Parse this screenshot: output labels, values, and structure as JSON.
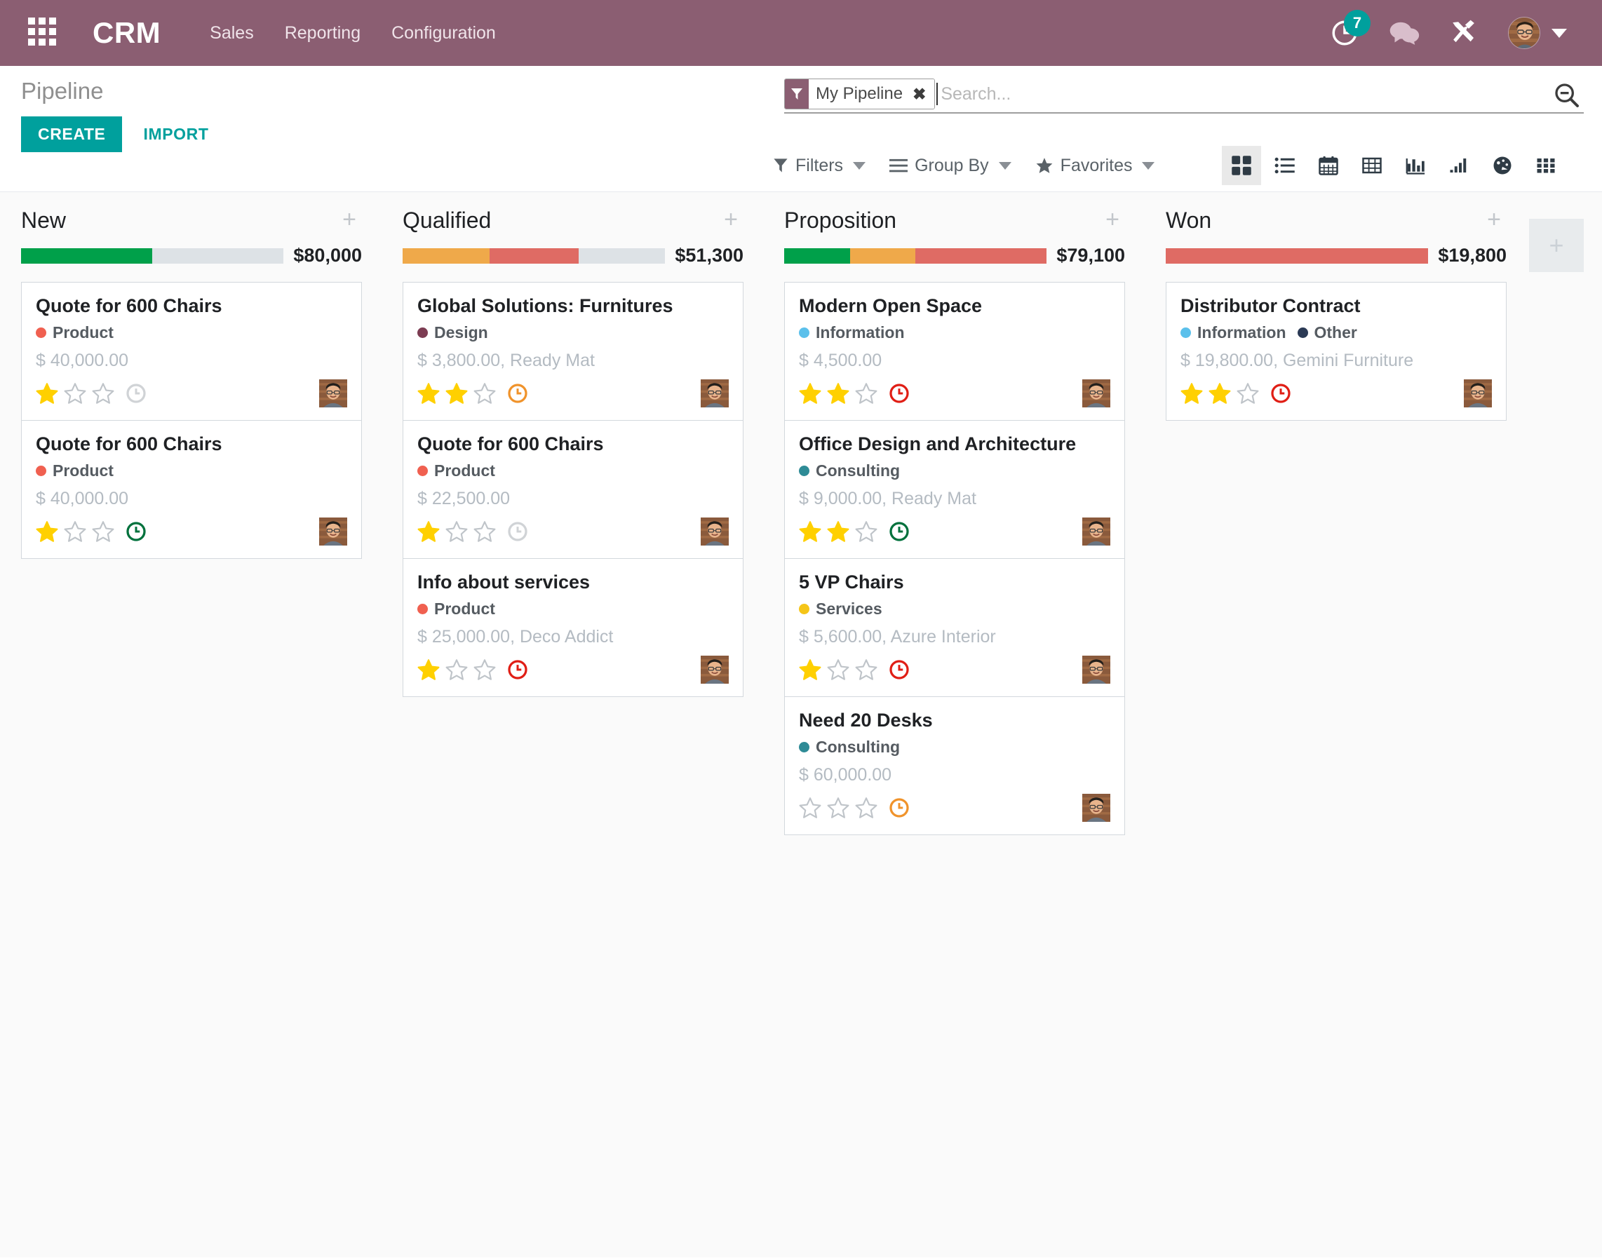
{
  "navbar": {
    "apps_icon": "apps-grid-icon",
    "brand": "CRM",
    "menu": [
      {
        "label": "Sales"
      },
      {
        "label": "Reporting"
      },
      {
        "label": "Configuration"
      }
    ],
    "activity_icon": "clock-activity-icon",
    "activity_count": "7",
    "messages_icon": "chat-bubbles-icon",
    "tools_icon": "tools-wrench-icon",
    "avatar_icon": "user-avatar",
    "user_caret_icon": "chevron-down-icon",
    "colors": {
      "bar": "#8B5E72",
      "badge": "#00A09D"
    }
  },
  "control_panel": {
    "title": "Pipeline",
    "create_label": "CREATE",
    "import_label": "IMPORT",
    "search": {
      "facet_label": "My Pipeline",
      "facet_icon": "filter-funnel-icon",
      "facet_close_icon": "close-x-icon",
      "placeholder": "Search...",
      "value": "",
      "magnifier_icon": "search-icon"
    },
    "filters_label": "Filters",
    "filters_icon": "filter-funnel-icon",
    "groupby_label": "Group By",
    "groupby_icon": "hamburger-lines-icon",
    "favorites_label": "Favorites",
    "favorites_icon": "star-icon",
    "views": [
      {
        "name": "kanban",
        "icon": "kanban-view-icon",
        "active": true
      },
      {
        "name": "list",
        "icon": "list-view-icon",
        "active": false
      },
      {
        "name": "calendar",
        "icon": "calendar-view-icon",
        "active": false
      },
      {
        "name": "pivot",
        "icon": "pivot-table-icon",
        "active": false
      },
      {
        "name": "graph",
        "icon": "bar-chart-icon",
        "active": false
      },
      {
        "name": "cohort",
        "icon": "ascending-bars-icon",
        "active": false
      },
      {
        "name": "dashboard",
        "icon": "gauge-dashboard-icon",
        "active": false
      },
      {
        "name": "activity",
        "icon": "grid-dots-icon",
        "active": false
      }
    ]
  },
  "colors": {
    "teal": "#00A09D",
    "green": "#00A04A",
    "orange": "#EFA94A",
    "red": "#DF6B64",
    "gray_bar": "#DDE2E6",
    "star_gold": "#FFD000",
    "clock_green": "#00713C",
    "clock_orange": "#F0932B",
    "clock_red": "#E01E15",
    "clock_gray": "#D0D3D6"
  },
  "kanban": {
    "add_column_icon": "plus-icon",
    "columns": [
      {
        "title": "New",
        "add_icon": "plus-icon",
        "amount": "$80,000",
        "progress": [
          {
            "color": "#00A04A",
            "pct": 50
          },
          {
            "color": "#DDE2E6",
            "pct": 50
          }
        ],
        "cards": [
          {
            "title": "Quote for 600 Chairs",
            "tags": [
              {
                "label": "Product",
                "color": "#F06050"
              }
            ],
            "amount": "$ 40,000.00",
            "stars_filled": 1,
            "stars_total": 3,
            "clock": "gray",
            "avatar": "user-avatar"
          },
          {
            "title": "Quote for 600 Chairs",
            "tags": [
              {
                "label": "Product",
                "color": "#F06050"
              }
            ],
            "amount": "$ 40,000.00",
            "stars_filled": 1,
            "stars_total": 3,
            "clock": "green",
            "avatar": "user-avatar"
          }
        ]
      },
      {
        "title": "Qualified",
        "add_icon": "plus-icon",
        "amount": "$51,300",
        "progress": [
          {
            "color": "#EFA94A",
            "pct": 33
          },
          {
            "color": "#DF6B64",
            "pct": 34
          },
          {
            "color": "#DDE2E6",
            "pct": 33
          }
        ],
        "cards": [
          {
            "title": "Global Solutions: Furnitures",
            "tags": [
              {
                "label": "Design",
                "color": "#7C3C52"
              }
            ],
            "amount": "$ 3,800.00, Ready Mat",
            "stars_filled": 2,
            "stars_total": 3,
            "clock": "orange",
            "avatar": "user-avatar"
          },
          {
            "title": "Quote for 600 Chairs",
            "tags": [
              {
                "label": "Product",
                "color": "#F06050"
              }
            ],
            "amount": "$ 22,500.00",
            "stars_filled": 1,
            "stars_total": 3,
            "clock": "gray",
            "avatar": "user-avatar"
          },
          {
            "title": "Info about services",
            "tags": [
              {
                "label": "Product",
                "color": "#F06050"
              }
            ],
            "amount": "$ 25,000.00, Deco Addict",
            "stars_filled": 1,
            "stars_total": 3,
            "clock": "red",
            "avatar": "user-avatar"
          }
        ]
      },
      {
        "title": "Proposition",
        "add_icon": "plus-icon",
        "amount": "$79,100",
        "progress": [
          {
            "color": "#00A04A",
            "pct": 25
          },
          {
            "color": "#EFA94A",
            "pct": 25
          },
          {
            "color": "#DF6B64",
            "pct": 50
          }
        ],
        "cards": [
          {
            "title": "Modern Open Space",
            "tags": [
              {
                "label": "Information",
                "color": "#5BC0EB"
              }
            ],
            "amount": "$ 4,500.00",
            "stars_filled": 2,
            "stars_total": 3,
            "clock": "red",
            "avatar": "user-avatar"
          },
          {
            "title": "Office Design and Architecture",
            "tags": [
              {
                "label": "Consulting",
                "color": "#2E8B96"
              }
            ],
            "amount": "$ 9,000.00, Ready Mat",
            "stars_filled": 2,
            "stars_total": 3,
            "clock": "green",
            "avatar": "user-avatar"
          },
          {
            "title": "5 VP Chairs",
            "tags": [
              {
                "label": "Services",
                "color": "#F5C518"
              }
            ],
            "amount": "$ 5,600.00, Azure Interior",
            "stars_filled": 1,
            "stars_total": 3,
            "clock": "red",
            "avatar": "user-avatar"
          },
          {
            "title": "Need 20 Desks",
            "tags": [
              {
                "label": "Consulting",
                "color": "#2E8B96"
              }
            ],
            "amount": "$ 60,000.00",
            "stars_filled": 0,
            "stars_total": 3,
            "clock": "orange",
            "avatar": "user-avatar"
          }
        ]
      },
      {
        "title": "Won",
        "add_icon": "plus-icon",
        "amount": "$19,800",
        "progress": [
          {
            "color": "#DF6B64",
            "pct": 100
          }
        ],
        "cards": [
          {
            "title": "Distributor Contract",
            "tags": [
              {
                "label": "Information",
                "color": "#5BC0EB"
              },
              {
                "label": "Other",
                "color": "#2B3A55"
              }
            ],
            "amount": "$ 19,800.00, Gemini Furniture",
            "stars_filled": 2,
            "stars_total": 3,
            "clock": "red",
            "avatar": "user-avatar"
          }
        ]
      }
    ]
  }
}
